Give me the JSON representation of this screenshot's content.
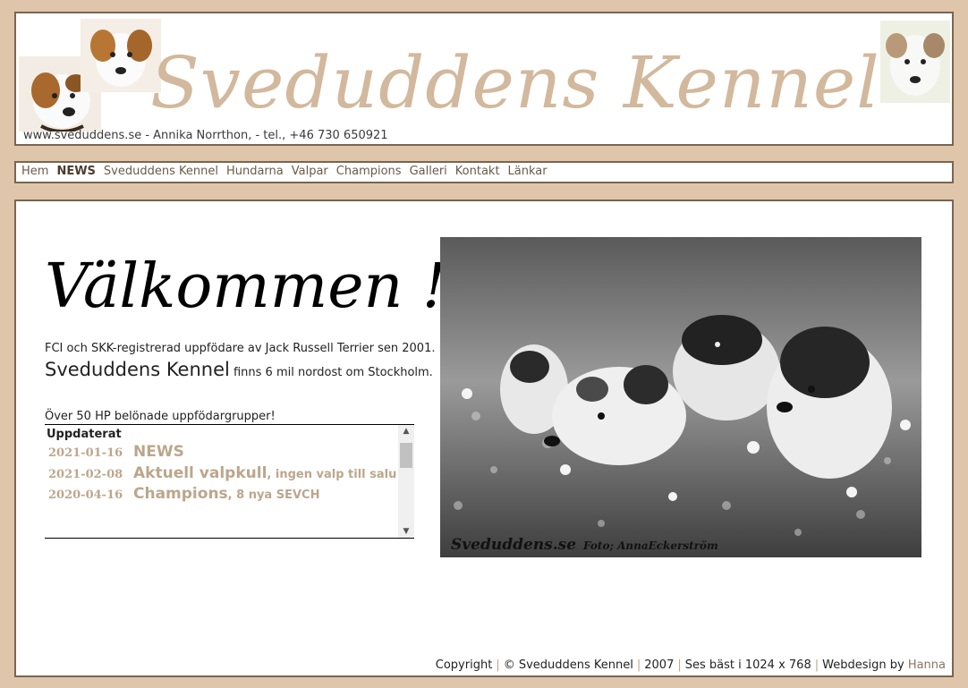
{
  "header": {
    "banner_title": "Sveduddens Kennel",
    "contact_line": "www.sveduddens.se - Annika Norrthon, - tel., +46 730 650921"
  },
  "nav": {
    "items": [
      {
        "label": "Hem",
        "active": false
      },
      {
        "label": "NEWS",
        "active": true
      },
      {
        "label": "Sveduddens Kennel",
        "active": false
      },
      {
        "label": "Hundarna",
        "active": false
      },
      {
        "label": "Valpar",
        "active": false
      },
      {
        "label": "Champions",
        "active": false
      },
      {
        "label": "Galleri",
        "active": false
      },
      {
        "label": "Kontakt",
        "active": false
      },
      {
        "label": "Länkar",
        "active": false
      }
    ]
  },
  "main": {
    "welcome_heading": "Välkommen !",
    "intro_line1": "FCI och SKK-registrerad uppfödare av Jack Russell Terrier sen 2001.",
    "intro_kennel": "Sveduddens Kennel",
    "intro_line2": " finns 6 mil nordost om Stockholm.",
    "hp_line": "Över 50 HP belönade uppfödargrupper!",
    "updates": {
      "heading": "Uppdaterat",
      "rows": [
        {
          "date": "2021-01-16",
          "title": "NEWS",
          "note": ""
        },
        {
          "date": "2021-02-08",
          "title": "Aktuell valpkull",
          "note": ", ingen valp till salu"
        },
        {
          "date": "2020-04-16",
          "title": "Champions",
          "note": ", 8 nya SEVCH"
        }
      ]
    },
    "photo": {
      "caption_site": "Sveduddens.se",
      "caption_foto": "Foto; AnnaEckerström"
    }
  },
  "footer": {
    "copyright": "Copyright",
    "owner": "© Sveduddens Kennel",
    "year": "2007",
    "resolution": "Ses bäst i 1024 x 768",
    "webdesign": "Webdesign by",
    "designer": "Hanna"
  },
  "colors": {
    "page_background": "#dfc5a9",
    "border": "#7a6550",
    "banner_text": "#d2b89c",
    "nav_link": "#6a5a48",
    "update_text": "#bca68c"
  },
  "icons": [
    "dog-photo-left",
    "dog-photo-middle",
    "dog-photo-right",
    "scroll-up-arrow",
    "scroll-down-arrow"
  ]
}
